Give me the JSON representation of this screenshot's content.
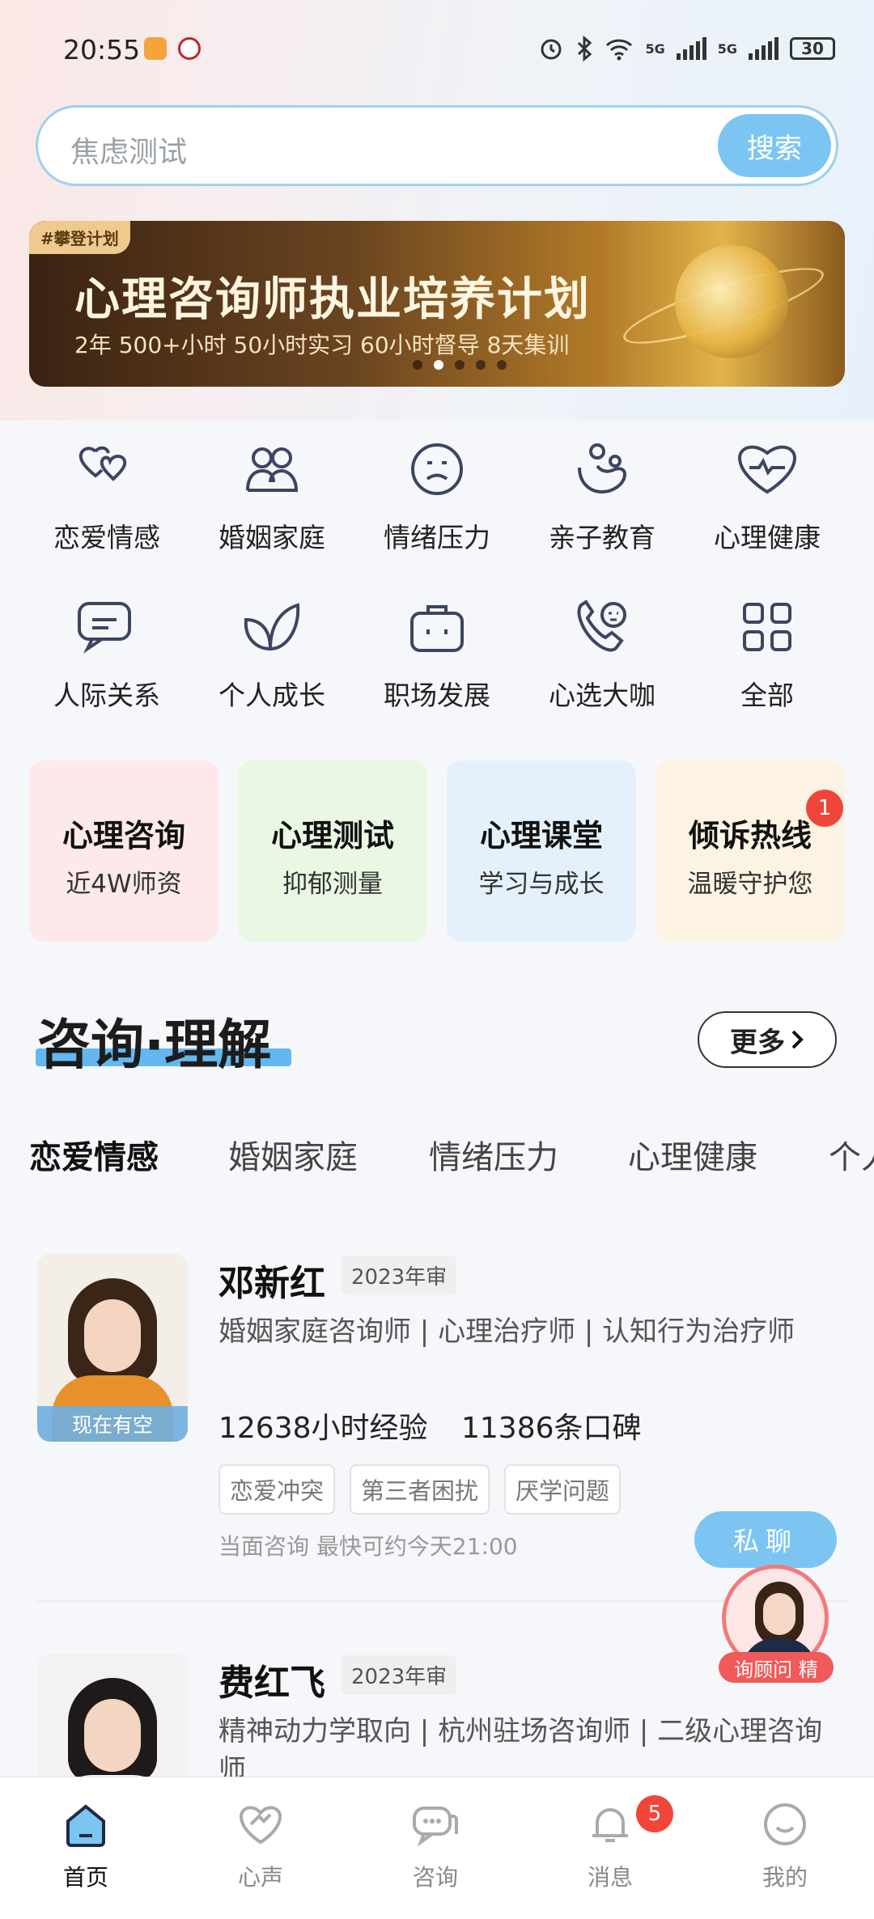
{
  "status": {
    "time": "20:55",
    "signal1": "5G",
    "signal2": "5G",
    "battery": "30"
  },
  "search": {
    "placeholder": "焦虑测试",
    "button": "搜索"
  },
  "banner": {
    "tag": "#攀登计划",
    "title": "心理咨询师执业培养计划",
    "subtitle": "2年 500+小时 50小时实习 60小时督导 8天集训",
    "active_slide": 2,
    "slides": 5
  },
  "categories": [
    {
      "label": "恋爱情感",
      "icon": "hearts-icon"
    },
    {
      "label": "婚姻家庭",
      "icon": "couple-icon"
    },
    {
      "label": "情绪压力",
      "icon": "sad-face-icon"
    },
    {
      "label": "亲子教育",
      "icon": "parent-child-icon"
    },
    {
      "label": "心理健康",
      "icon": "heart-pulse-icon"
    },
    {
      "label": "人际关系",
      "icon": "chat-bubble-icon"
    },
    {
      "label": "个人成长",
      "icon": "leaf-icon"
    },
    {
      "label": "职场发展",
      "icon": "briefcase-icon"
    },
    {
      "label": "心选大咖",
      "icon": "phone-icon"
    },
    {
      "label": "全部",
      "icon": "grid-icon"
    }
  ],
  "features": [
    {
      "title": "心理咨询",
      "subtitle": "近4W师资",
      "bg": "#fde9ea"
    },
    {
      "title": "心理测试",
      "subtitle": "抑郁测量",
      "bg": "#e9f7e3"
    },
    {
      "title": "心理课堂",
      "subtitle": "学习与成长",
      "bg": "#e4f1fc"
    },
    {
      "title": "倾诉热线",
      "subtitle": "温暖守护您",
      "bg": "#fdf3e2",
      "badge": "1"
    }
  ],
  "section": {
    "title": "咨询·理解",
    "more": "更多"
  },
  "tabs": [
    "恋爱情感",
    "婚姻家庭",
    "情绪压力",
    "心理健康",
    "个人成长"
  ],
  "counselors": [
    {
      "name": "邓新红",
      "year": "2023年审",
      "desc": "婚姻家庭咨询师 | 心理治疗师 | 认知行为治疗师",
      "hours": "12638小时经验",
      "reviews": "11386条口碑",
      "tags": [
        "恋爱冲突",
        "第三者困扰",
        "厌学问题"
      ],
      "meta": "当面咨询   最快可约今天21:00",
      "status": "现在有空",
      "chat": "私聊"
    },
    {
      "name": "费红飞",
      "year": "2023年审",
      "desc": "精神动力学取向 | 杭州驻场咨询师 | 二级心理咨询师"
    }
  ],
  "floating": {
    "label": "询顾问 精"
  },
  "nav": [
    {
      "label": "首页",
      "icon": "home-icon"
    },
    {
      "label": "心声",
      "icon": "heart-voice-icon"
    },
    {
      "label": "咨询",
      "icon": "consult-icon"
    },
    {
      "label": "消息",
      "icon": "bell-icon",
      "badge": "5"
    },
    {
      "label": "我的",
      "icon": "profile-icon"
    }
  ],
  "colors": {
    "accent": "#7cc5f3",
    "badge": "#f0463a",
    "underline": "#62b8ef"
  }
}
